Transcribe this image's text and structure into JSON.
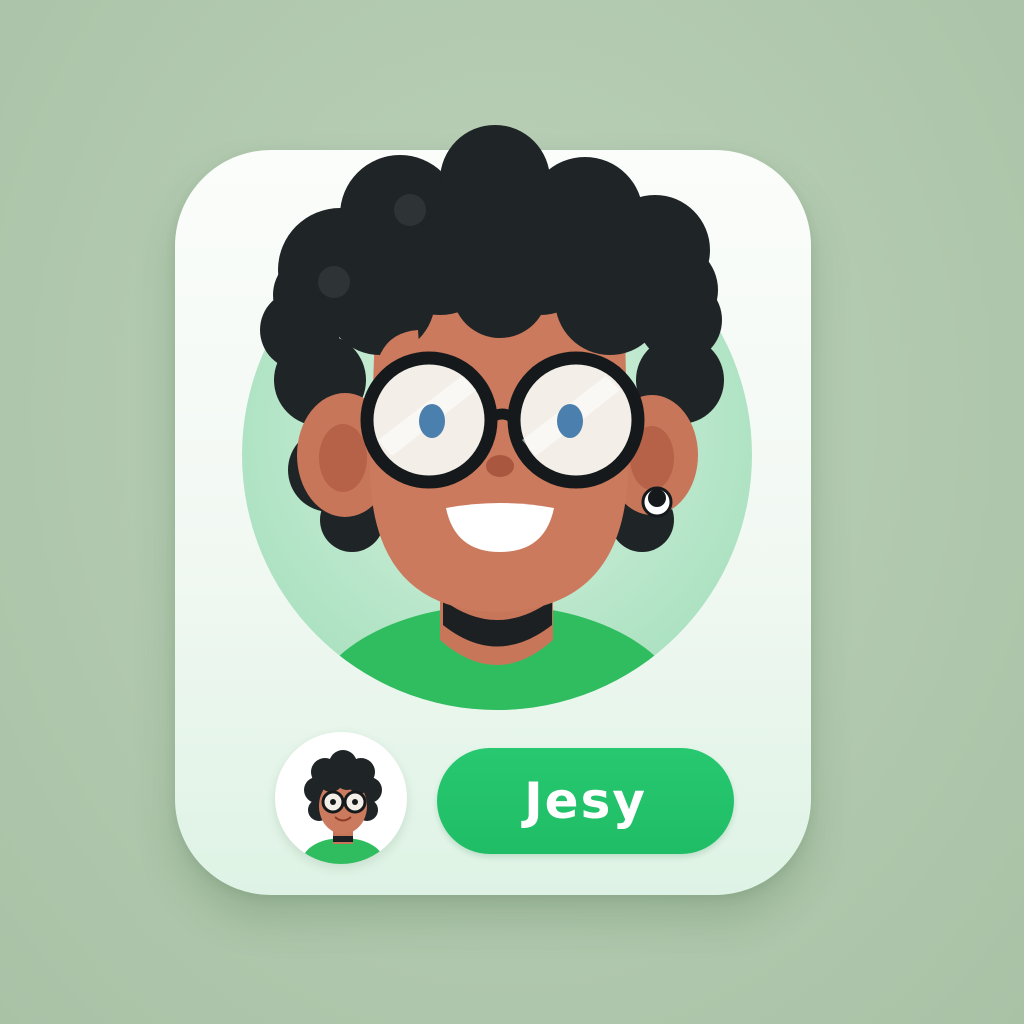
{
  "profile": {
    "name": "Jesy",
    "avatar_icon": "person-avatar-curly-hair-glasses-icon",
    "small_avatar_icon": "person-avatar-thumbnail-icon"
  },
  "colors": {
    "background": "#b4cab2",
    "card": "#f6fbf7",
    "accent": "#22c46b",
    "circle": "#bde8cf",
    "shirt": "#2fbd5f",
    "skin": "#c8765a",
    "hair": "#1f2426"
  }
}
